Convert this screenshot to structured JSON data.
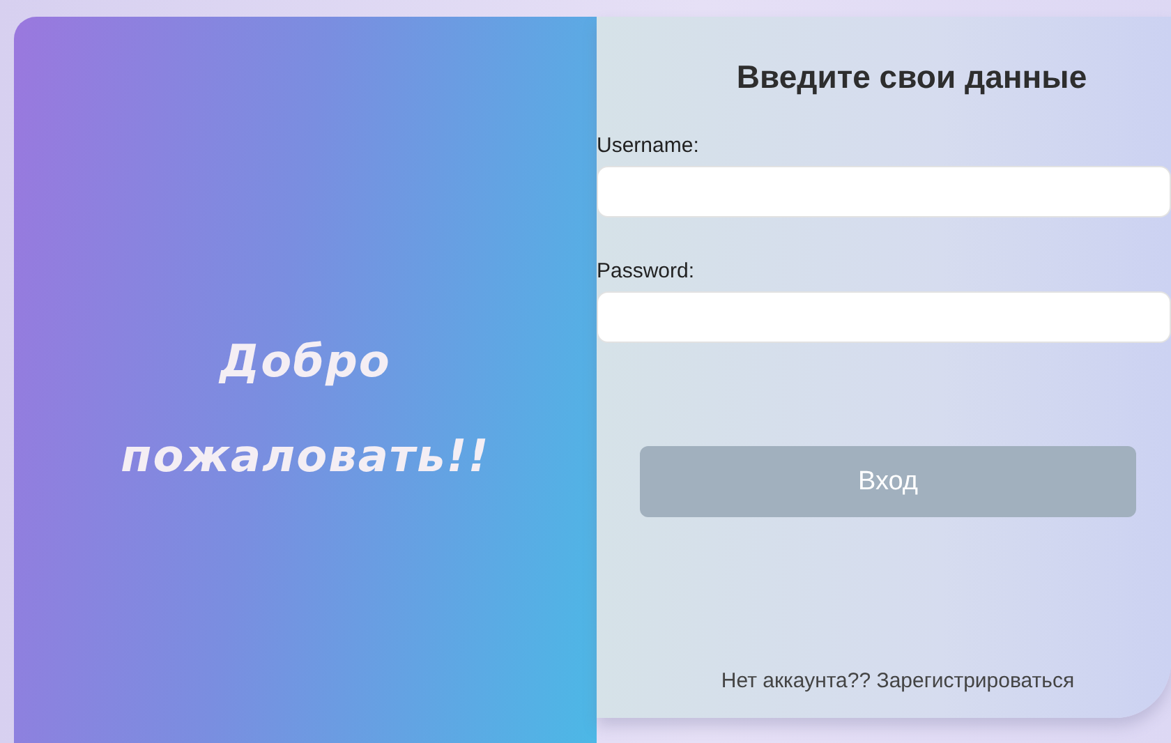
{
  "welcome": {
    "lines": [
      "Добро",
      "пожаловать!!"
    ]
  },
  "form": {
    "title": "Введите свои данные",
    "fields": [
      {
        "label": "Username:"
      },
      {
        "label": "Password:"
      }
    ],
    "submit": "Вход",
    "footer": "Нет аккаунта?? Зарегистрироваться"
  }
}
